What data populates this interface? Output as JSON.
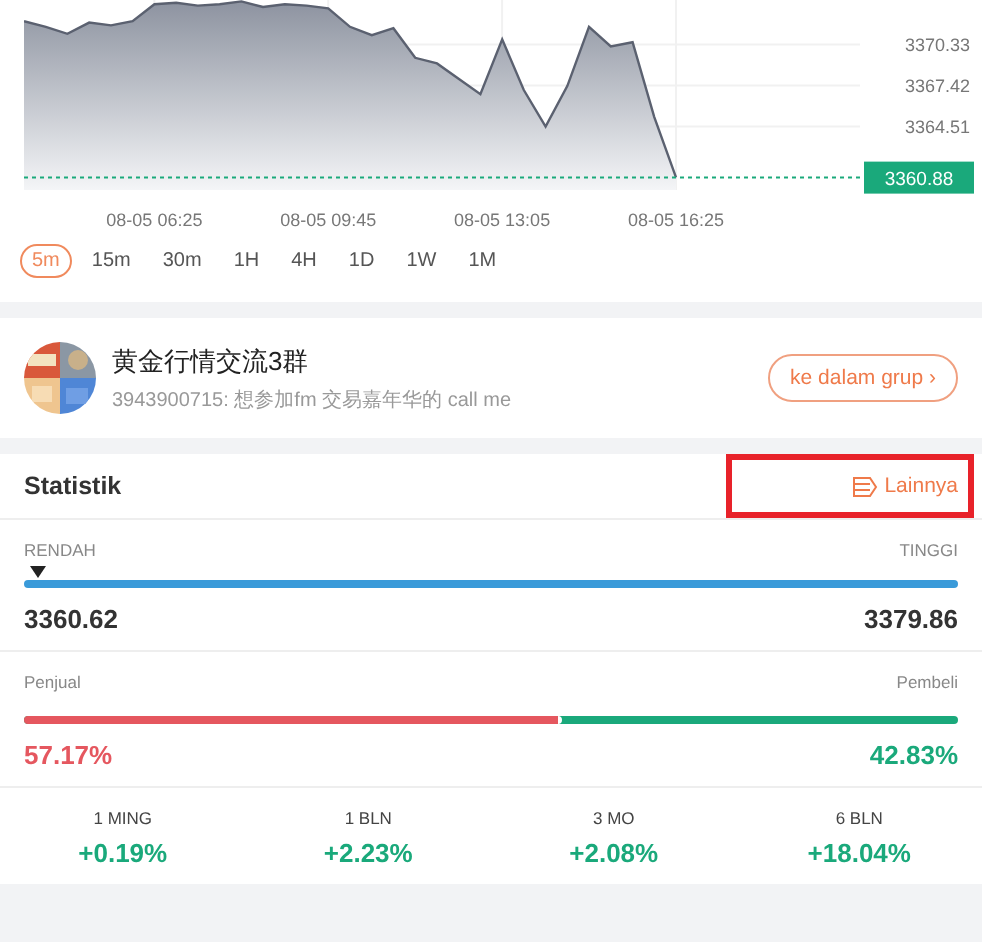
{
  "chart": {
    "chart_data": {
      "type": "area",
      "categories": [
        null,
        null,
        null,
        null,
        null,
        null,
        "08-05 06:25",
        null,
        null,
        null,
        null,
        null,
        null,
        null,
        "08-05 09:45",
        null,
        null,
        null,
        null,
        null,
        null,
        null,
        "08-05 13:05",
        null,
        null,
        null,
        null,
        null,
        null,
        null,
        "08-05 16:25"
      ],
      "series": [
        {
          "color": "#5b6170",
          "values": [
            3372.0,
            3371.6,
            3371.1,
            3371.9,
            3371.7,
            3372.0,
            3373.2,
            3373.3,
            3373.1,
            3373.2,
            3373.4,
            3373.0,
            3373.2,
            3373.1,
            3372.9,
            3371.6,
            3371.0,
            3371.5,
            3369.4,
            3369.0,
            3367.9,
            3366.8,
            3370.7,
            3367.1,
            3364.5,
            3367.4,
            3371.6,
            3370.2,
            3370.5,
            3365.2,
            3360.9
          ]
        }
      ],
      "ylim": [
        3360.0,
        3373.5
      ],
      "yticks": [
        3370.33,
        3367.42,
        3364.51
      ],
      "grid": true,
      "ref_lines": [
        {
          "axis": "y",
          "value": 3360.88,
          "label": "3360.88",
          "color": "#1aa97b"
        }
      ]
    },
    "timeframes": [
      {
        "label": "5m",
        "selected": true
      },
      {
        "label": "15m",
        "selected": false
      },
      {
        "label": "30m",
        "selected": false
      },
      {
        "label": "1H",
        "selected": false
      },
      {
        "label": "4H",
        "selected": false
      },
      {
        "label": "1D",
        "selected": false
      },
      {
        "label": "1W",
        "selected": false
      },
      {
        "label": "1M",
        "selected": false
      }
    ]
  },
  "group": {
    "name": "黄金行情交流3群",
    "last_message": "3943900715: 想参加fm 交易嘉年华的 call me",
    "button": "ke dalam grup ›"
  },
  "statistics": {
    "title": "Statistik",
    "more_link": {
      "label": "Lainnya",
      "highlighted": true
    },
    "range": {
      "low_label": "RENDAH",
      "high_label": "TINGGI",
      "level": 0.014,
      "low": "3360.62",
      "high": "3379.86"
    },
    "sentiment": {
      "seller_label": "Penjual",
      "buyer_label": "Pembeli",
      "level": 0.5717,
      "seller": "57.17%",
      "buyer": "42.83%"
    },
    "periods": [
      {
        "label": "1 MING",
        "value": "+0.19%"
      },
      {
        "label": "1 BLN",
        "value": "+2.23%"
      },
      {
        "label": "3 MO",
        "value": "+2.08%"
      },
      {
        "label": "6 BLN",
        "value": "+18.04%"
      }
    ]
  }
}
